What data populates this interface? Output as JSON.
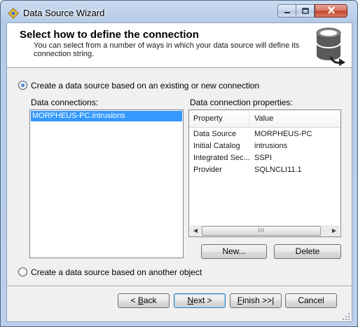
{
  "window": {
    "title": "Data Source Wizard"
  },
  "header": {
    "title": "Select how to define the connection",
    "subtitle": "You can select from a number of ways in which your data source will define its connection string."
  },
  "option_existing": {
    "label": "Create a data source based on an existing or new connection",
    "selected": true
  },
  "data_connections": {
    "label": "Data connections:",
    "items": [
      "MORPHEUS-PC.intrusions"
    ],
    "selected_index": 0
  },
  "properties": {
    "label": "Data connection properties:",
    "columns": [
      "Property",
      "Value"
    ],
    "rows": [
      {
        "property": "Data Source",
        "value": "MORPHEUS-PC"
      },
      {
        "property": "Initial Catalog",
        "value": "intrusions"
      },
      {
        "property": "Integrated Sec...",
        "value": "SSPI"
      },
      {
        "property": "Provider",
        "value": "SQLNCLI11.1"
      }
    ],
    "scroll_grip": "III"
  },
  "buttons": {
    "new": "New...",
    "delete": "Delete",
    "back_prefix": "< ",
    "back_key": "B",
    "back_rest": "ack",
    "next_key": "N",
    "next_rest": "ext >",
    "finish_key": "F",
    "finish_rest": "inish >>|",
    "cancel": "Cancel"
  },
  "option_other": {
    "label": "Create a data source based on another object",
    "selected": false
  },
  "icons": [
    "app-wizard-icon",
    "minimize-icon",
    "maximize-icon",
    "close-icon",
    "database-icon",
    "size-grip-icon"
  ],
  "colors": {
    "selection": "#3399ff",
    "close_button": "#c2412c",
    "title_bar": "#b5cbe6"
  }
}
